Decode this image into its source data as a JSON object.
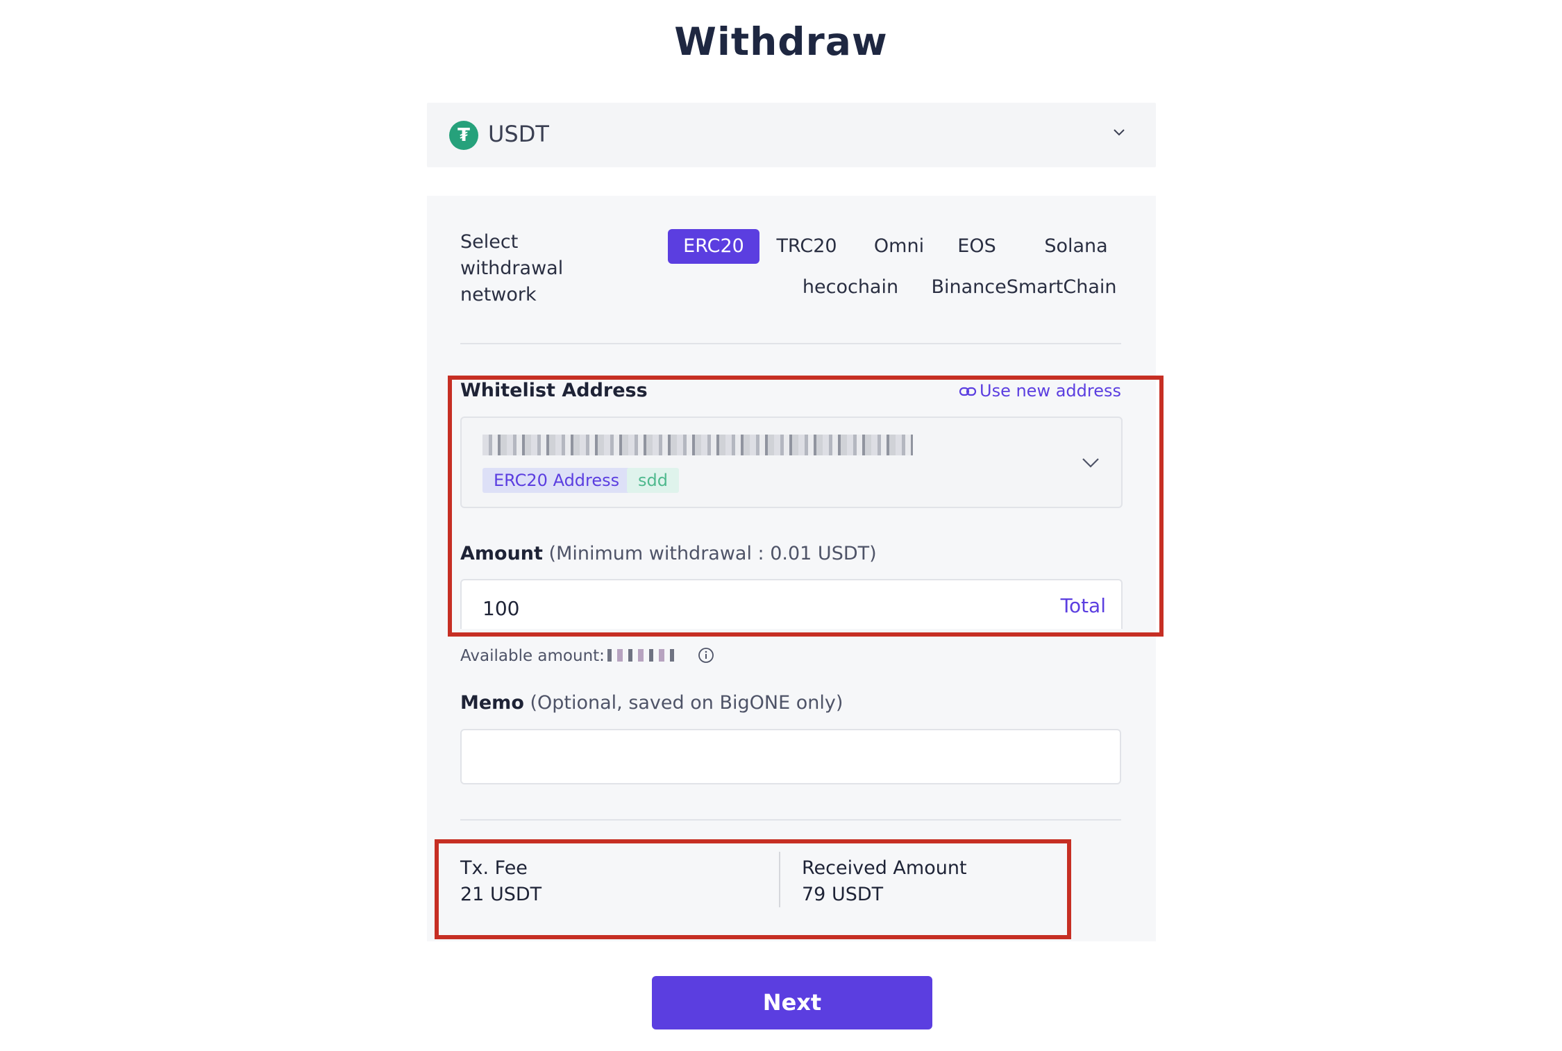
{
  "page": {
    "title": "Withdraw"
  },
  "coin": {
    "symbol": "USDT",
    "icon": "tether-icon",
    "icon_glyph": "₮",
    "icon_color": "#26a17b"
  },
  "network": {
    "label": "Select withdrawal network",
    "options": [
      "ERC20",
      "TRC20",
      "Omni",
      "EOS",
      "Solana",
      "hecochain",
      "BinanceSmartChain"
    ],
    "selected": "ERC20"
  },
  "whitelist": {
    "label": "Whitelist Address",
    "use_new_label": "Use new address",
    "tags": [
      "ERC20 Address",
      "sdd"
    ]
  },
  "amount": {
    "label": "Amount",
    "hint": "(Minimum withdrawal : 0.01 USDT)",
    "value": "100",
    "total_label": "Total"
  },
  "available": {
    "label": "Available amount:"
  },
  "memo": {
    "label": "Memo",
    "hint": "(Optional, saved on BigONE only)",
    "value": ""
  },
  "fees": {
    "tx_fee_label": "Tx. Fee",
    "tx_fee_value": "21 USDT",
    "received_label": "Received Amount",
    "received_value": "79 USDT"
  },
  "actions": {
    "next_label": "Next"
  },
  "colors": {
    "accent": "#5b3ee0",
    "highlight": "#c62f24"
  }
}
